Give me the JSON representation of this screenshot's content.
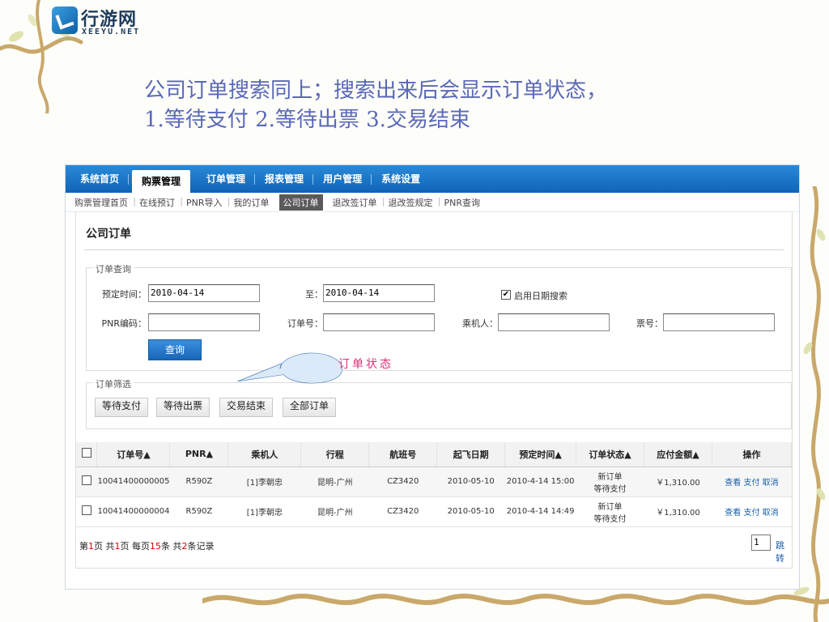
{
  "logo": {
    "cn": "行游网",
    "en": "XEEYU.NET"
  },
  "heading": {
    "line1": "公司订单搜索同上；搜索出来后会显示订单状态，",
    "line2": "1.等待支付 2.等待出票 3.交易结束"
  },
  "topnav": [
    "系统首页",
    "购票管理",
    "订单管理",
    "报表管理",
    "用户管理",
    "系统设置"
  ],
  "topnav_active": "购票管理",
  "subnav": [
    "购票管理首页",
    "在线预订",
    "PNR导入",
    "我的订单",
    "公司订单",
    "退改签订单",
    "退改签规定",
    "PNR查询"
  ],
  "subnav_active": "公司订单",
  "panel": {
    "title": "公司订单"
  },
  "query": {
    "legend": "订单查询",
    "book_time_label": "预定时间：",
    "book_time_from": "2010-04-14",
    "to_label": "至：",
    "book_time_to": "2010-04-14",
    "date_search_label": "启用日期搜索",
    "date_search_checked": "✔",
    "pnr_label": "PNR编码：",
    "order_no_label": "订单号：",
    "passenger_label": "乘机人：",
    "ticket_label": "票号：",
    "search_button": "查询"
  },
  "callout": {
    "text": "订单状态"
  },
  "filter": {
    "legend": "订单筛选",
    "buttons": [
      "等待支付",
      "等待出票",
      "交易结束",
      "全部订单"
    ]
  },
  "table": {
    "headers": [
      "订单号▲",
      "PNR▲",
      "乘机人",
      "行程",
      "航班号",
      "起飞日期",
      "预定时间▲",
      "订单状态▲",
      "应付金额▲",
      "操作"
    ],
    "rows": [
      {
        "order_no": "10041400000005",
        "pnr": "R590Z",
        "passenger": "[1]李朝忠",
        "route": "昆明-广州",
        "flight": "CZ3420",
        "depart": "2010-05-10",
        "booked": "2010-4-14 15:00",
        "status1": "新订单",
        "status2": "等待支付",
        "amount": "￥1,310.00",
        "op_view": "查看",
        "op_pay": "支付",
        "op_cancel": "取消"
      },
      {
        "order_no": "10041400000004",
        "pnr": "R590Z",
        "passenger": "[1]李朝忠",
        "route": "昆明-广州",
        "flight": "CZ3420",
        "depart": "2010-05-10",
        "booked": "2010-4-14 14:49",
        "status1": "新订单",
        "status2": "等待支付",
        "amount": "￥1,310.00",
        "op_view": "查看",
        "op_pay": "支付",
        "op_cancel": "取消"
      }
    ]
  },
  "pager": {
    "p1": "第",
    "page": "1",
    "p2": "页 共",
    "pages": "1",
    "p3": "页 每页",
    "per": "15",
    "p4": "条 共",
    "total": "2",
    "p5": "条记录",
    "input": "1",
    "go": "跳转"
  }
}
